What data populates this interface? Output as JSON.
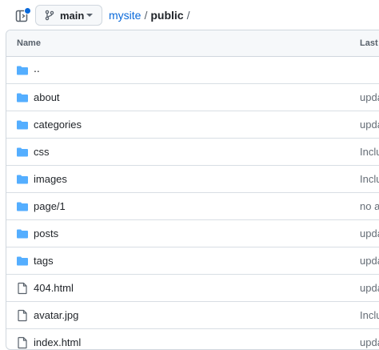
{
  "header": {
    "branch": "main",
    "breadcrumb": {
      "repo": "mysite",
      "separator": "/",
      "current": "public",
      "trailing": "/"
    }
  },
  "table": {
    "columns": {
      "name": "Name",
      "last_commit": "Last c"
    },
    "up_row": "..",
    "rows": [
      {
        "name": "about",
        "type": "folder",
        "message": "upda"
      },
      {
        "name": "categories",
        "type": "folder",
        "message": "upda"
      },
      {
        "name": "css",
        "type": "folder",
        "message": "Inclu"
      },
      {
        "name": "images",
        "type": "folder",
        "message": "Inclu"
      },
      {
        "name": "page/1",
        "type": "folder",
        "message": "no ar"
      },
      {
        "name": "posts",
        "type": "folder",
        "message": "upda"
      },
      {
        "name": "tags",
        "type": "folder",
        "message": "upda"
      },
      {
        "name": "404.html",
        "type": "file",
        "message": "upda"
      },
      {
        "name": "avatar.jpg",
        "type": "file",
        "message": "Inclu"
      },
      {
        "name": "index.html",
        "type": "file",
        "message": "upda"
      }
    ]
  },
  "colors": {
    "accent": "#0969da",
    "folder": "#54aeff",
    "file_icon": "#57606a"
  }
}
